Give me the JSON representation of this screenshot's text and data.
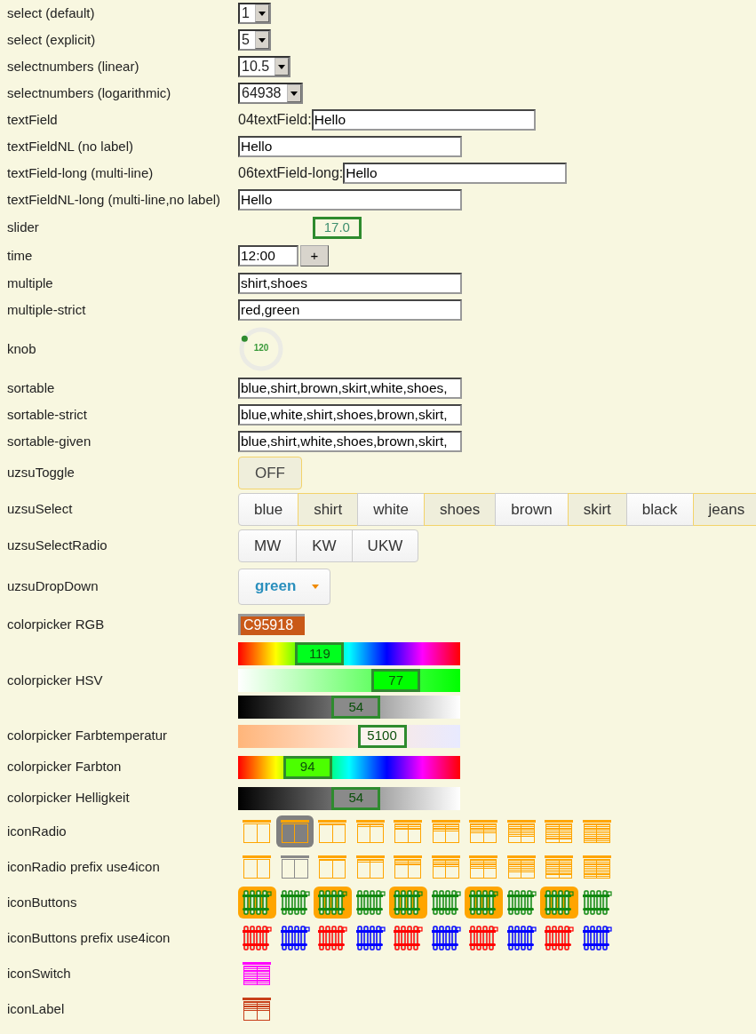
{
  "rows": [
    {
      "label": "select (default)",
      "kind": "select",
      "value": "1"
    },
    {
      "label": "select (explicit)",
      "kind": "select",
      "value": "5"
    },
    {
      "label": "selectnumbers (linear)",
      "kind": "select",
      "value": "10.5"
    },
    {
      "label": "selectnumbers (logarithmic)",
      "kind": "select",
      "value": "64938"
    },
    {
      "label": "textField",
      "kind": "text",
      "prefix": "04textField:",
      "value": "Hello"
    },
    {
      "label": "textFieldNL (no label)",
      "kind": "text",
      "value": "Hello"
    },
    {
      "label": "textField-long (multi-line)",
      "kind": "text",
      "prefix": "06textField-long:",
      "value": "Hello"
    },
    {
      "label": "textFieldNL-long (multi-line,no label)",
      "kind": "text",
      "value": "Hello"
    },
    {
      "label": "slider",
      "kind": "slider",
      "value": "17.0",
      "level": 0.43
    },
    {
      "label": "time",
      "kind": "time",
      "value": "12:00",
      "button": "+"
    },
    {
      "label": "multiple",
      "kind": "text",
      "value": "shirt,shoes"
    },
    {
      "label": "multiple-strict",
      "kind": "text",
      "value": "red,green"
    },
    {
      "label": "knob",
      "kind": "knob",
      "value": "120",
      "level": 0
    },
    {
      "label": "sortable",
      "kind": "text",
      "value": "blue,shirt,brown,skirt,white,shoes,"
    },
    {
      "label": "sortable-strict",
      "kind": "text",
      "value": "blue,white,shirt,shoes,brown,skirt,"
    },
    {
      "label": "sortable-given",
      "kind": "text",
      "value": "blue,shirt,white,shoes,brown,skirt,"
    },
    {
      "label": "uzsuToggle",
      "kind": "toggle",
      "value": "OFF",
      "on": false
    },
    {
      "label": "uzsuSelect",
      "kind": "segmented",
      "options": [
        {
          "text": "blue",
          "selected": false
        },
        {
          "text": "shirt",
          "selected": true
        },
        {
          "text": "white",
          "selected": false
        },
        {
          "text": "shoes",
          "selected": true
        },
        {
          "text": "brown",
          "selected": false
        },
        {
          "text": "skirt",
          "selected": true
        },
        {
          "text": "black",
          "selected": false
        },
        {
          "text": "jeans",
          "selected": true
        }
      ]
    },
    {
      "label": "uzsuSelectRadio",
      "kind": "segmented",
      "options": [
        {
          "text": "MW",
          "selected": false
        },
        {
          "text": "KW",
          "selected": false
        },
        {
          "text": "UKW",
          "selected": false
        }
      ]
    },
    {
      "label": "uzsuDropDown",
      "kind": "dropdown",
      "value": "green"
    },
    {
      "label": "colorpicker RGB",
      "kind": "colorhex",
      "value": "C95918",
      "color": "#c95918"
    },
    {
      "label": "colorpicker HSV",
      "kind": "colorbars",
      "bars": [
        {
          "kind": "hue",
          "value": "119",
          "level": 0.33
        },
        {
          "kind": "saturation",
          "value": "77",
          "level": 0.77
        },
        {
          "kind": "brightness",
          "value": "54",
          "level": 0.54
        }
      ]
    },
    {
      "label": "colorpicker Farbtemperatur",
      "kind": "colorbars",
      "bars": [
        {
          "kind": "temperature",
          "value": "5100",
          "level": 0.69
        }
      ]
    },
    {
      "label": "colorpicker Farbton",
      "kind": "colorbars",
      "bars": [
        {
          "kind": "hue",
          "value": "94",
          "level": 0.26
        }
      ]
    },
    {
      "label": "colorpicker Helligkeit",
      "kind": "colorbars",
      "bars": [
        {
          "kind": "brightness",
          "value": "54",
          "level": 0.54
        }
      ]
    },
    {
      "label": "iconRadio",
      "kind": "shutters_bg",
      "icons": [
        {
          "selected": false
        },
        {
          "selected": true
        },
        {
          "level": 0.1,
          "selected": false
        },
        {
          "level": 0.2,
          "selected": false
        },
        {
          "level": 0.3,
          "selected": false
        },
        {
          "level": 0.4,
          "selected": false
        },
        {
          "level": 0.55,
          "selected": false
        },
        {
          "level": 0.7,
          "selected": false
        },
        {
          "level": 0.85,
          "selected": false
        },
        {
          "level": 1,
          "selected": false
        }
      ]
    },
    {
      "label": "iconRadio prefix use4icon",
      "kind": "shutters_tint",
      "icons": [
        {
          "selected": false
        },
        {
          "selected": true
        },
        {
          "level": 0.1,
          "selected": false
        },
        {
          "level": 0.2,
          "selected": false
        },
        {
          "level": 0.3,
          "selected": false
        },
        {
          "level": 0.4,
          "selected": false
        },
        {
          "level": 0.55,
          "selected": false
        },
        {
          "level": 0.7,
          "selected": false
        },
        {
          "level": 0.85,
          "selected": false
        },
        {
          "level": 1,
          "selected": false
        }
      ]
    },
    {
      "label": "iconButtons",
      "kind": "radiators",
      "icons": [
        {
          "selected": true
        },
        {
          "selected": false
        },
        {
          "selected": true
        },
        {
          "selected": false
        },
        {
          "selected": true
        },
        {
          "selected": false
        },
        {
          "selected": true
        },
        {
          "selected": false
        },
        {
          "selected": true
        },
        {
          "selected": false
        }
      ]
    },
    {
      "label": "iconButtons prefix use4icon",
      "kind": "radiators",
      "icons": [
        {
          "color": "#ff0000"
        },
        {
          "color": "#0000ff"
        },
        {
          "color": "#ff0000"
        },
        {
          "color": "#0000ff"
        },
        {
          "color": "#ff0000"
        },
        {
          "color": "#0000ff"
        },
        {
          "color": "#ff0000"
        },
        {
          "color": "#0000ff"
        },
        {
          "color": "#ff0000"
        },
        {
          "color": "#0000ff"
        }
      ]
    },
    {
      "label": "iconSwitch",
      "kind": "shutters",
      "icons": [
        {
          "level": 1,
          "color": "#ff00ff"
        }
      ]
    },
    {
      "label": "iconLabel",
      "kind": "shutters",
      "icons": [
        {
          "level": 0.5,
          "color": "#c8401a"
        }
      ]
    }
  ]
}
